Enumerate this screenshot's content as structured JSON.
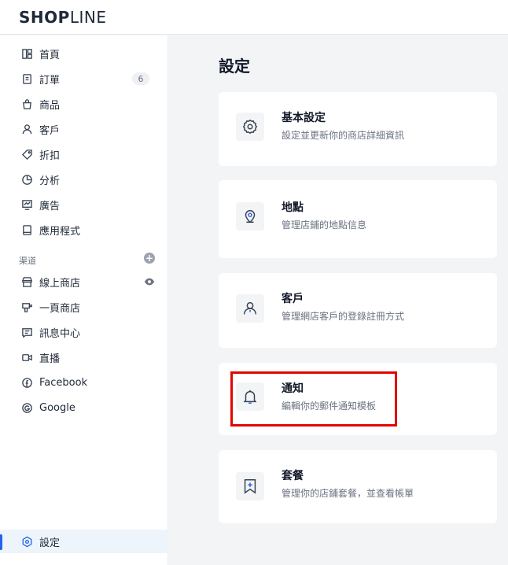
{
  "brand": {
    "logo_bold": "SHOP",
    "logo_light": "LINE"
  },
  "sidebar": {
    "items": [
      {
        "label": "首頁",
        "icon": "grid-icon"
      },
      {
        "label": "訂單",
        "icon": "order-icon",
        "badge": "6"
      },
      {
        "label": "商品",
        "icon": "bag-icon"
      },
      {
        "label": "客戶",
        "icon": "person-icon"
      },
      {
        "label": "折扣",
        "icon": "tag-icon"
      },
      {
        "label": "分析",
        "icon": "chart-icon"
      },
      {
        "label": "廣告",
        "icon": "monitor-icon"
      },
      {
        "label": "應用程式",
        "icon": "app-icon"
      }
    ],
    "channels_label": "渠道",
    "channels": [
      {
        "label": "線上商店",
        "icon": "store-icon"
      },
      {
        "label": "一頁商店",
        "icon": "page-store-icon"
      },
      {
        "label": "訊息中心",
        "icon": "message-icon"
      },
      {
        "label": "直播",
        "icon": "video-icon"
      },
      {
        "label": "Facebook",
        "icon": "facebook-icon"
      },
      {
        "label": "Google",
        "icon": "google-icon"
      }
    ],
    "settings": {
      "label": "設定",
      "icon": "settings-icon"
    }
  },
  "main": {
    "title": "設定",
    "cards": [
      {
        "title": "基本設定",
        "desc": "設定並更新你的商店詳細資訊",
        "icon": "gear-icon"
      },
      {
        "title": "地點",
        "desc": "管理店鋪的地點信息",
        "icon": "location-icon"
      },
      {
        "title": "客戶",
        "desc": "管理網店客戶的登錄註冊方式",
        "icon": "person-icon"
      },
      {
        "title": "通知",
        "desc": "編輯你的郵件通知模板",
        "icon": "bell-icon"
      },
      {
        "title": "套餐",
        "desc": "管理你的店鋪套餐，並查看帳單",
        "icon": "bookmark-plus-icon"
      }
    ]
  },
  "colors": {
    "accent": "#2563eb",
    "highlight": "#e10600"
  }
}
